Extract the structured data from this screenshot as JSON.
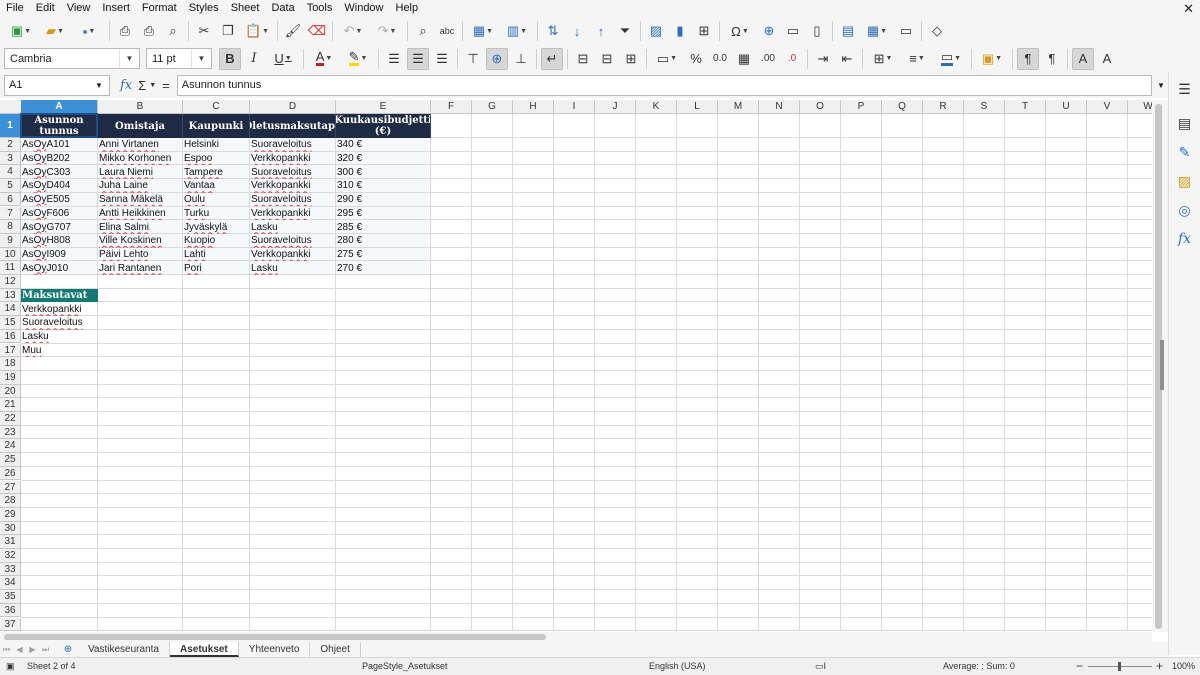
{
  "menu": [
    "File",
    "Edit",
    "View",
    "Insert",
    "Format",
    "Styles",
    "Sheet",
    "Data",
    "Tools",
    "Window",
    "Help"
  ],
  "font_name": "Cambria",
  "font_size": "11 pt",
  "name_box": "A1",
  "formula_icons": {
    "fx": "fx",
    "sum": "Σ",
    "eq": "="
  },
  "formula_value": "Asunnon tunnus",
  "columns": [
    "A",
    "B",
    "C",
    "D",
    "E",
    "F",
    "G",
    "H",
    "I",
    "J",
    "K",
    "L",
    "M",
    "N",
    "O",
    "P",
    "Q",
    "R",
    "S",
    "T",
    "U",
    "V",
    "W"
  ],
  "rows": [
    "1",
    "2",
    "3",
    "4",
    "5",
    "6",
    "7",
    "8",
    "9",
    "10",
    "11",
    "12",
    "13",
    "14",
    "15",
    "16",
    "17",
    "18",
    "19",
    "20",
    "21",
    "22",
    "23",
    "24",
    "25",
    "26",
    "27",
    "28",
    "29",
    "30",
    "31",
    "32",
    "33",
    "34",
    "35",
    "36",
    "37"
  ],
  "header": {
    "col_a": "Asunnon tunnus",
    "col_b": "Omistaja",
    "col_c": "Kaupunki",
    "col_d": "Oletusmaksutapa",
    "col_e": "Kuukausibudjetti (€)"
  },
  "data_rows": [
    [
      "As Oy A101",
      "Anni Virtanen",
      "Helsinki",
      "Suoraveloitus",
      "340 €"
    ],
    [
      "As Oy B202",
      "Mikko Korhonen",
      "Espoo",
      "Verkkopankki",
      "320 €"
    ],
    [
      "As Oy C303",
      "Laura Niemi",
      "Tampere",
      "Suoraveloitus",
      "300 €"
    ],
    [
      "As Oy D404",
      "Juha Laine",
      "Vantaa",
      "Verkkopankki",
      "310 €"
    ],
    [
      "As Oy E505",
      "Sanna Mäkelä",
      "Oulu",
      "Suoraveloitus",
      "290 €"
    ],
    [
      "As Oy F606",
      "Antti Heikkinen",
      "Turku",
      "Verkkopankki",
      "295 €"
    ],
    [
      "As Oy G707",
      "Elina Salmi",
      "Jyväskylä",
      "Lasku",
      "285 €"
    ],
    [
      "As Oy H808",
      "Ville Koskinen",
      "Kuopio",
      "Suoraveloitus",
      "280 €"
    ],
    [
      "As Oy I909",
      "Päivi Lehto",
      "Lahti",
      "Verkkopankki",
      "275 €"
    ],
    [
      "As Oy J010",
      "Jari Rantanen",
      "Pori",
      "Lasku",
      "270 €"
    ]
  ],
  "payment_header": "Maksutavat",
  "payment_methods": [
    "Verkkopankki",
    "Suoraveloitus",
    "Lasku",
    "Muu"
  ],
  "tabs": [
    "Vastikeseuranta",
    "Asetukset",
    "Yhteenveto",
    "Ohjeet"
  ],
  "active_tab": "Asetukset",
  "status": {
    "sheet": "Sheet 2 of 4",
    "page_style": "PageStyle_Asetukset",
    "language": "English (USA)",
    "summary": "Average: ; Sum: 0",
    "zoom": "100%"
  },
  "colors": {
    "header_bg": "#1f2a44",
    "teal": "#127a73",
    "selection": "#3d8fd6"
  }
}
